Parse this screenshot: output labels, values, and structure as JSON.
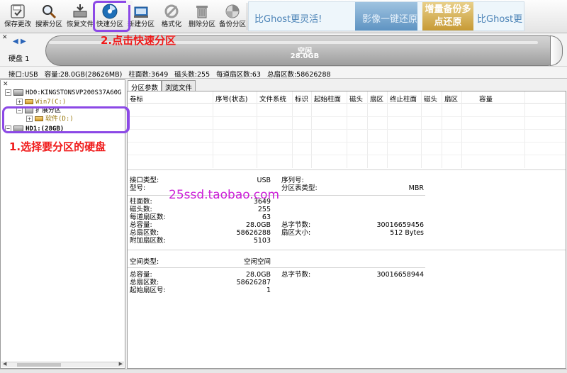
{
  "toolbar": {
    "buttons": [
      {
        "label": "保存更改",
        "icon": "save-changes-icon"
      },
      {
        "label": "搜索分区",
        "icon": "search-partition-icon"
      },
      {
        "label": "恢复文件",
        "icon": "recover-files-icon"
      },
      {
        "label": "快速分区",
        "icon": "quick-partition-icon"
      },
      {
        "label": "新建分区",
        "icon": "new-partition-icon"
      },
      {
        "label": "格式化",
        "icon": "format-icon"
      },
      {
        "label": "删除分区",
        "icon": "delete-partition-icon"
      },
      {
        "label": "备份分区",
        "icon": "backup-partition-icon"
      }
    ]
  },
  "banner": {
    "text1": "比Ghost更灵活!",
    "text2": "影像一键还原",
    "text3": "增量备份多点还原",
    "text4": "比Ghost更"
  },
  "disk_bar": {
    "disk_label": "硬盘 1",
    "partition_name": "空闲",
    "partition_size": "28.0GB"
  },
  "info_line": {
    "interface": "接口:USB",
    "capacity": "容量:28.0GB(28626MB)",
    "cylinders": "柱面数:3649",
    "heads": "磁头数:255",
    "sectors_per_track": "每道扇区数:63",
    "total_sectors": "总扇区数:58626288"
  },
  "tree": {
    "items": [
      {
        "label": "HD0:KINGSTONSVP200S37A60G",
        "toggle": "−"
      },
      {
        "label": "Win7(C:)",
        "toggle": "+"
      },
      {
        "label": "扩展分区",
        "toggle": "−"
      },
      {
        "label": "软件(D:)",
        "toggle": "+"
      },
      {
        "label": "HD1:(28GB)",
        "toggle": "−"
      }
    ]
  },
  "tabs": {
    "params": "分区参数",
    "browse": "浏览文件"
  },
  "columns": [
    "卷标",
    "序号(状态)",
    "文件系统",
    "标识",
    "起始柱面",
    "磁头",
    "扇区",
    "终止柱面",
    "磁头",
    "扇区",
    "容量"
  ],
  "disk_info": {
    "interface_label": "接口类型:",
    "interface_value": "USB",
    "model_label": "型号:",
    "serial_label": "序列号:",
    "table_type_label": "分区表类型:",
    "table_type_value": "MBR",
    "cylinders_label": "柱面数:",
    "cylinders_value": "3649",
    "heads_label": "磁头数:",
    "heads_value": "255",
    "spt_label": "每道扇区数:",
    "spt_value": "63",
    "capacity_label": "总容量:",
    "capacity_value": "28.0GB",
    "total_bytes_label": "总字节数:",
    "total_bytes_value": "30016659456",
    "sectors_label": "总扇区数:",
    "sectors_value": "58626288",
    "sector_size_label": "扇区大小:",
    "sector_size_value": "512 Bytes",
    "extra_sectors_label": "附加扇区数:",
    "extra_sectors_value": "5103"
  },
  "space_info": {
    "type_label": "空间类型:",
    "type_value": "空闲空间",
    "capacity_label": "总容量:",
    "capacity_value": "28.0GB",
    "bytes_label": "总字节数:",
    "bytes_value": "30016658944",
    "sectors_label": "总扇区数:",
    "sectors_value": "58626287",
    "start_label": "起始扇区号:",
    "start_value": "1"
  },
  "annotations": {
    "step1": "1.选择要分区的硬盘",
    "step2": "2.点击快速分区",
    "watermark": "25ssd.taobao.com"
  },
  "colors": {
    "highlight": "#8c49e6",
    "annotation": "#f01b1b",
    "watermark": "#cc1fd8"
  }
}
